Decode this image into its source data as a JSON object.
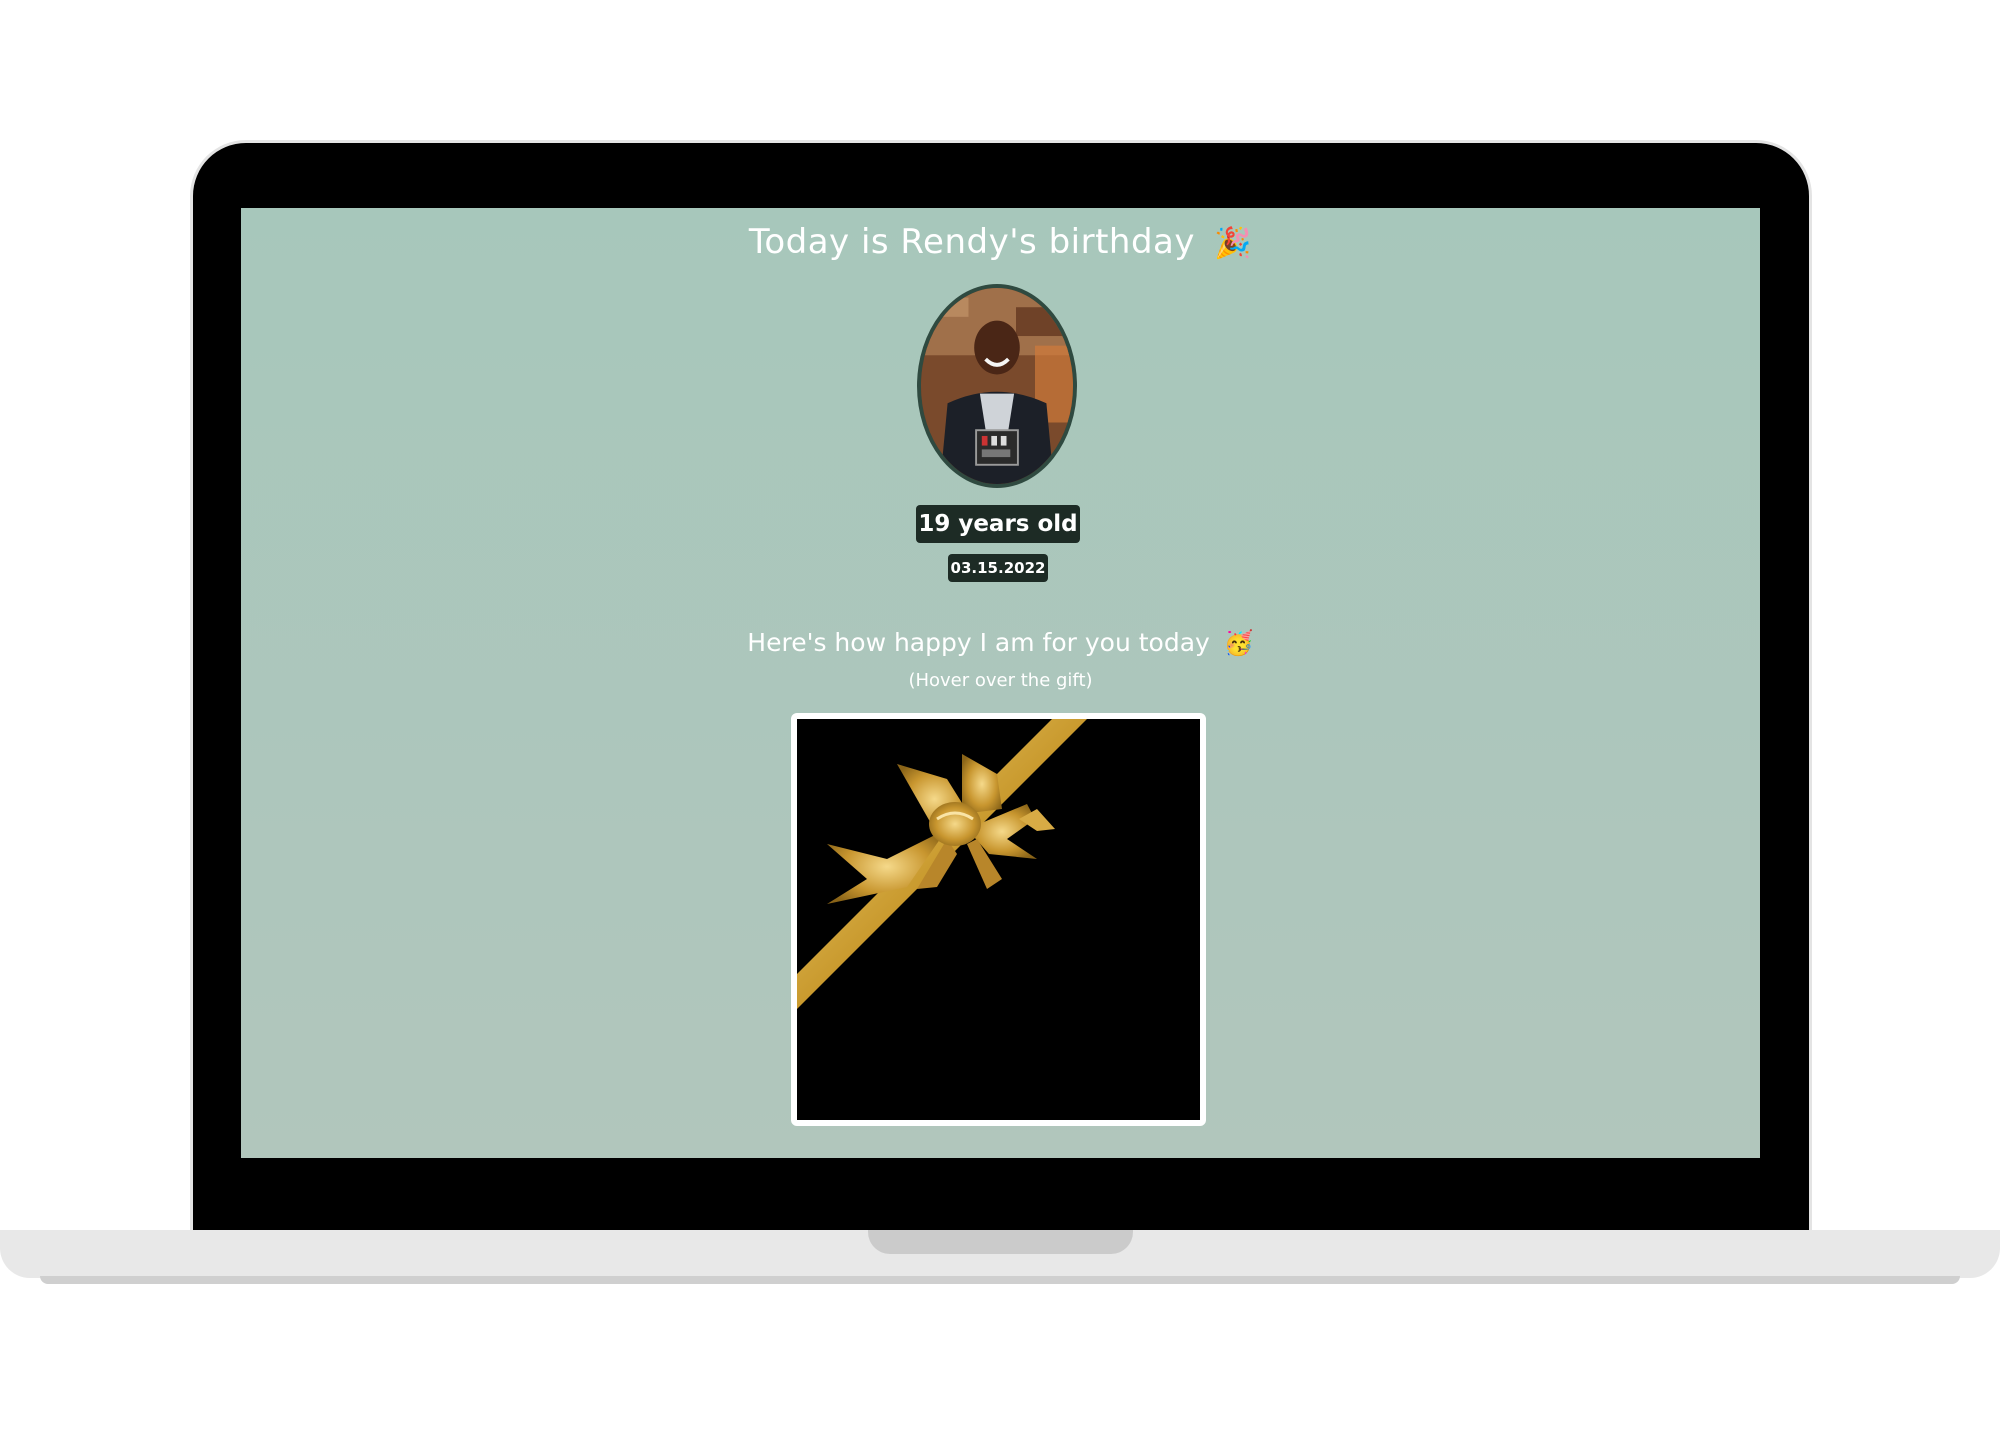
{
  "page": {
    "title": "Today is Rendy's birthday",
    "title_emoji": "🎉",
    "age_label": "19 years old",
    "date_label": "03.15.2022",
    "message": "Here's how happy I am for you today",
    "message_emoji": "🥳",
    "hint": "(Hover over the gift)"
  },
  "colors": {
    "background": "#a9c6bb",
    "badge": "#1d2b25",
    "ribbon": "#d4a93a",
    "gift": "#000000"
  },
  "icons": {
    "title_emoji": "party-popper-icon",
    "message_emoji": "partying-face-icon",
    "gift": "gift-bow-icon"
  }
}
